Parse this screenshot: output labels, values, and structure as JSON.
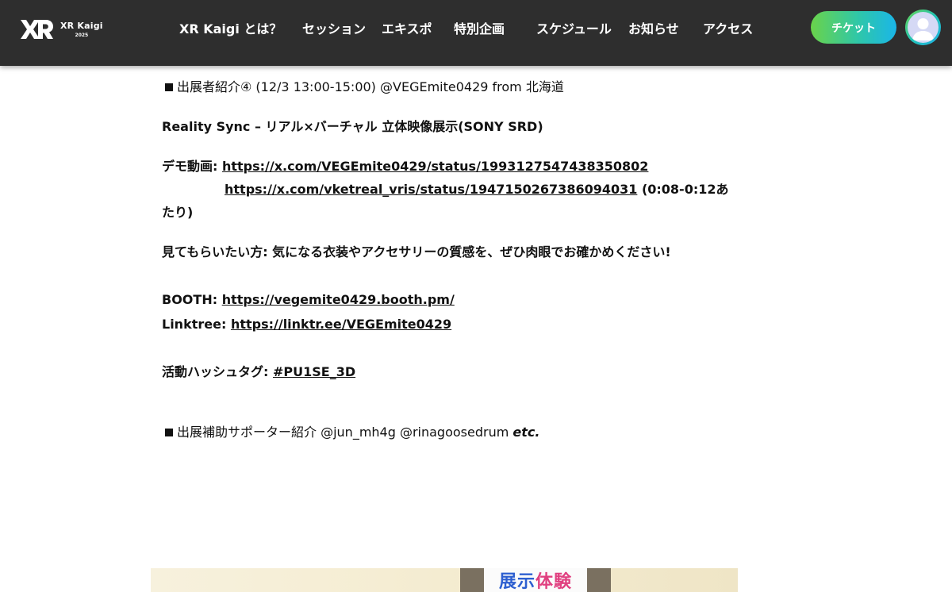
{
  "header": {
    "logo": {
      "name": "XR Kaigi",
      "year": "2025"
    },
    "nav": [
      {
        "label": "XR Kaigi とは？"
      },
      {
        "label": "セッション"
      },
      {
        "label": "エキスポ"
      },
      {
        "label": "特別企画"
      },
      {
        "label": "スケジュール"
      },
      {
        "label": "お知らせ"
      },
      {
        "label": "アクセス"
      }
    ],
    "ticket_label": "チケット"
  },
  "article": {
    "exhibitor_heading": "出展者紹介④ (12/3 13:00-15:00) @VEGEmite0429 from 北海道",
    "title": "Reality Sync – リアル×バーチャル 立体映像展示(SONY SRD)",
    "demo_label": "デモ動画:",
    "demo_link_1": "https://x.com/VEGEmite0429/status/1993127547438350802",
    "demo_link_2": "https://x.com/vketreal_vris/status/1947150267386094031",
    "demo_link_2_suffix": " (0:08-0:12あ",
    "demo_link_2_wrap": "たり)",
    "highlight": "見てもらいたい方: 気になる衣装やアクセサリーの質感を、ぜひ肉眼でお確かめください!",
    "booth_label": "BOOTH:",
    "booth_link": "https://vegemite0429.booth.pm/",
    "linktree_label": "Linktree:",
    "linktree_link": "https://linktr.ee/VEGEmite0429",
    "hashtag_label": "活動ハッシュタグ:",
    "hashtag_link": "#PU1SE_3D",
    "supporter_heading": "出展補助サポーター紹介 @jun_mh4g @rinagoosedrum",
    "supporter_etc": "etc."
  },
  "photo": {
    "sign_part1": "展示",
    "sign_part2": "体験"
  },
  "colors": {
    "header_bg": "#2e2e2e",
    "ticket_gradient_start": "#6ad34a",
    "ticket_gradient_end": "#1ab6e8",
    "text": "#111111"
  },
  "icons": {
    "logo": "xr-logo-icon",
    "avatar": "user-avatar-icon",
    "bullet": "black-square-icon"
  }
}
